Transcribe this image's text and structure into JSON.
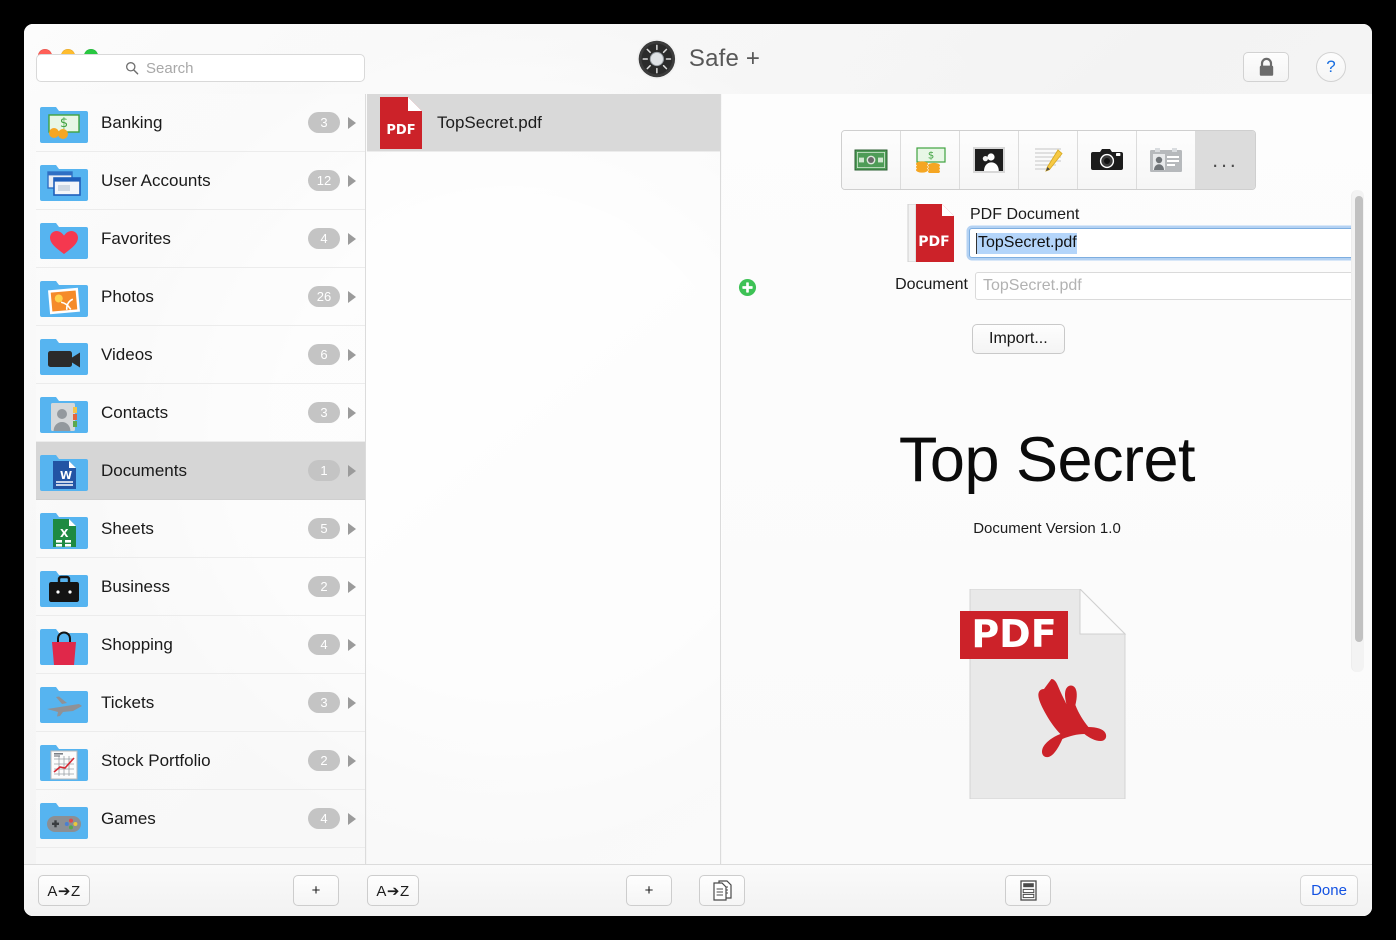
{
  "window": {
    "app_title": "Safe +",
    "logo_icon": "safe-dial-icon",
    "traffic_lights": [
      "close",
      "minimize",
      "zoom"
    ]
  },
  "search": {
    "placeholder": "Search",
    "value": "",
    "icon": "search-icon"
  },
  "titlebar_actions": {
    "lock_icon": "lock-icon",
    "help_label": "?"
  },
  "sidebar": {
    "items": [
      {
        "label": "Banking",
        "count": "3",
        "icon": "folder-banknote-icon"
      },
      {
        "label": "User Accounts",
        "count": "12",
        "icon": "folder-windows-icon"
      },
      {
        "label": "Favorites",
        "count": "4",
        "icon": "folder-heart-icon"
      },
      {
        "label": "Photos",
        "count": "26",
        "icon": "folder-photo-icon"
      },
      {
        "label": "Videos",
        "count": "6",
        "icon": "folder-videocamera-icon"
      },
      {
        "label": "Contacts",
        "count": "3",
        "icon": "folder-contacts-icon"
      },
      {
        "label": "Documents",
        "count": "1",
        "icon": "folder-word-doc-icon",
        "selected": true
      },
      {
        "label": "Sheets",
        "count": "5",
        "icon": "folder-excel-sheet-icon"
      },
      {
        "label": "Business",
        "count": "2",
        "icon": "folder-briefcase-icon"
      },
      {
        "label": "Shopping",
        "count": "4",
        "icon": "folder-shopping-bag-icon"
      },
      {
        "label": "Tickets",
        "count": "3",
        "icon": "folder-airplane-icon"
      },
      {
        "label": "Stock Portfolio",
        "count": "2",
        "icon": "folder-chart-icon"
      },
      {
        "label": "Games",
        "count": "4",
        "icon": "folder-gamepad-icon"
      }
    ]
  },
  "list": {
    "items": [
      {
        "label": "TopSecret.pdf",
        "icon": "pdf-file-icon",
        "selected": true
      }
    ]
  },
  "detail": {
    "type_toolbar": [
      {
        "name": "banknote-type",
        "icon": "banknote-icon",
        "active": false
      },
      {
        "name": "money-type",
        "icon": "money-stack-icon",
        "active": false
      },
      {
        "name": "picture-type",
        "icon": "picture-frame-icon",
        "active": false
      },
      {
        "name": "note-type",
        "icon": "note-pencil-icon",
        "active": false
      },
      {
        "name": "camera-type",
        "icon": "camera-icon",
        "active": false
      },
      {
        "name": "idcard-type",
        "icon": "id-card-icon",
        "active": false
      },
      {
        "name": "more-types",
        "icon": "ellipsis-icon",
        "active": true,
        "label": "..."
      }
    ],
    "type_label": "PDF Document",
    "type_icon": "pdf-file-icon",
    "title_value": "TopSecret.pdf",
    "add_row_icon": "green-plus-icon",
    "document_label": "Document",
    "document_placeholder": "TopSecret.pdf",
    "document_value": "",
    "import_label": "Import...",
    "preview": {
      "heading": "Top Secret",
      "subheading": "Document Version 1.0",
      "icon": "pdf-document-large-icon",
      "icon_banner_text": "PDF"
    }
  },
  "bottom_bar": {
    "sort_sidebar_label": "A➔Z",
    "add_sidebar_label": "+",
    "sort_list_label": "A➔Z",
    "add_list_label": "+",
    "duplicate_icon": "duplicate-document-icon",
    "template_icon": "template-layout-icon",
    "done_label": "Done"
  },
  "colors": {
    "accent_blue": "#1352e2",
    "help_blue": "#1a6fe0",
    "pdf_red": "#cc2229",
    "folder_blue": "#56b4f0",
    "selection_gray": "#d6d6d6",
    "focus_ring": "#7eaee0",
    "text_selection": "#b4d5fa",
    "green_plus": "#3dc255"
  }
}
